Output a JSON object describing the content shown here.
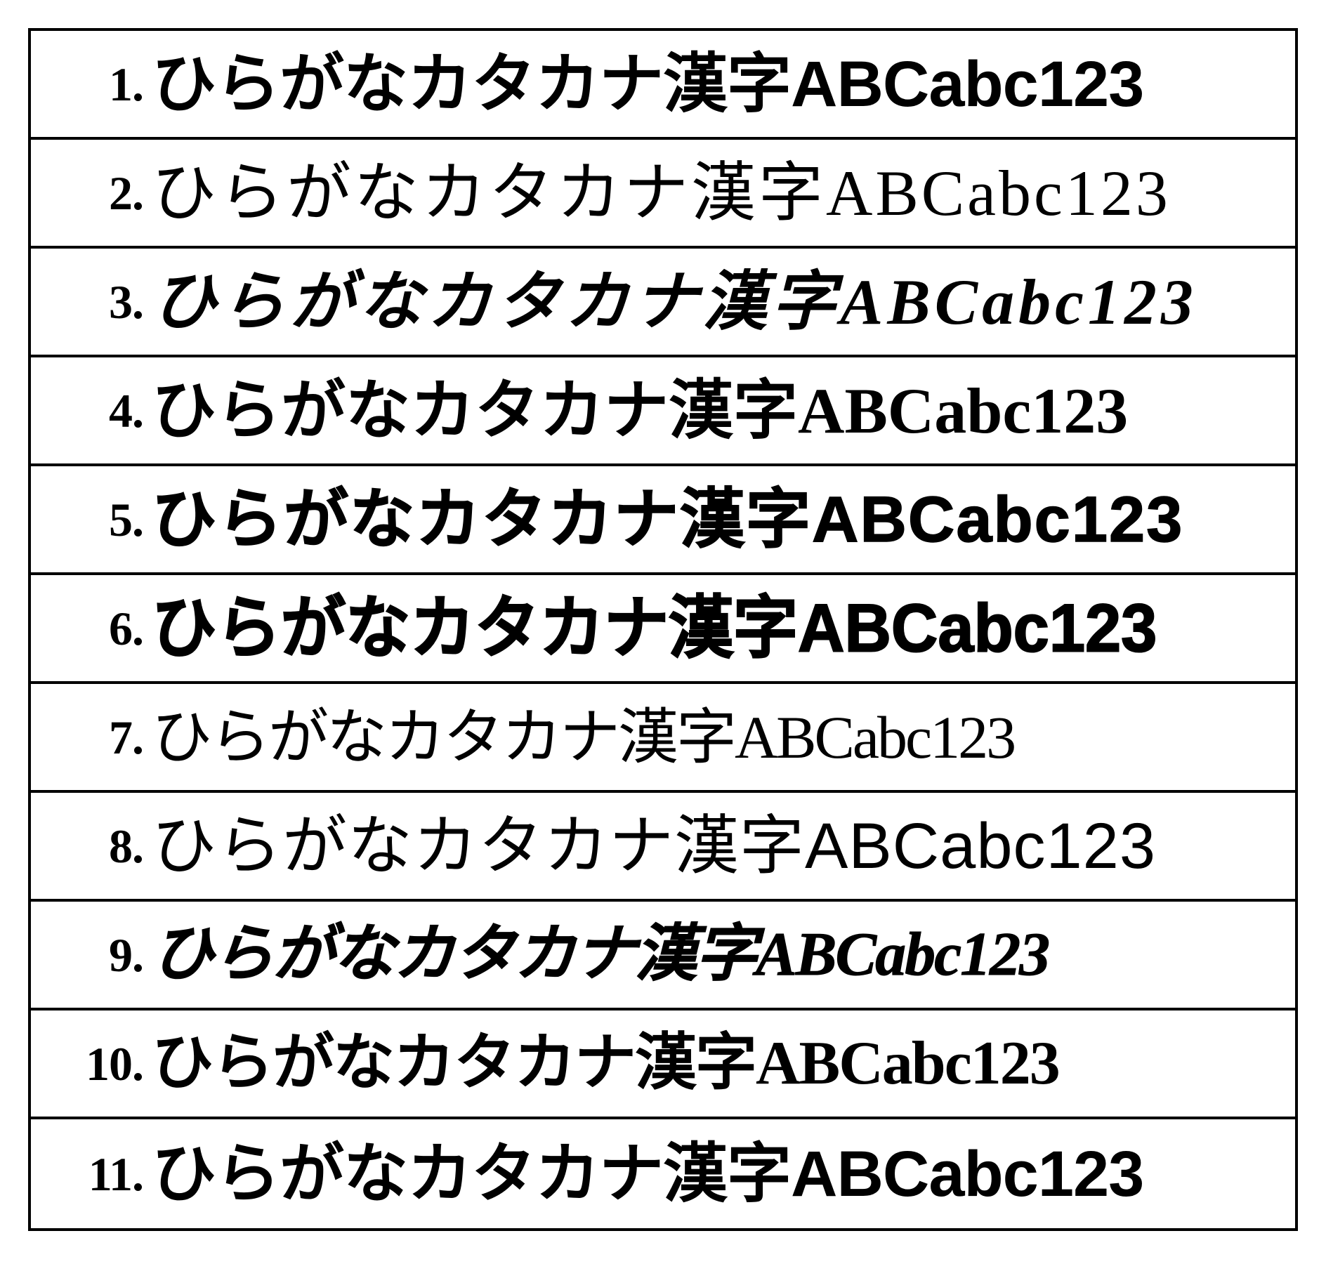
{
  "sample_text": "ひらがなカタカナ漢字ABCabc123",
  "rows": [
    {
      "number": "1.",
      "sample": "ひらがなカタカナ漢字ABCabc123"
    },
    {
      "number": "2.",
      "sample": "ひらがなカタカナ漢字ABCabc123"
    },
    {
      "number": "3.",
      "sample": "ひらがなカタカナ漢字ABCabc123"
    },
    {
      "number": "4.",
      "sample": "ひらがなカタカナ漢字ABCabc123"
    },
    {
      "number": "5.",
      "sample": "ひらがなカタカナ漢字ABCabc123"
    },
    {
      "number": "6.",
      "sample": "ひらがなカタカナ漢字ABCabc123"
    },
    {
      "number": "7.",
      "sample": "ひらがなカタカナ漢字ABCabc123"
    },
    {
      "number": "8.",
      "sample": "ひらがなカタカナ漢字ABCabc123"
    },
    {
      "number": "9.",
      "sample": "ひらがなカタカナ漢字ABCabc123"
    },
    {
      "number": "10.",
      "sample": "ひらがなカタカナ漢字ABCabc123"
    },
    {
      "number": "11.",
      "sample": "ひらがなカタカナ漢字ABCabc123"
    }
  ]
}
